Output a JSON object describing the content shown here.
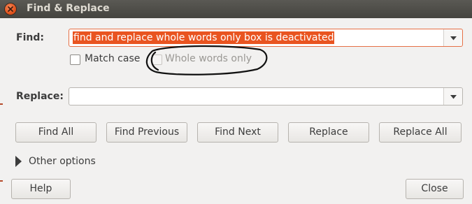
{
  "window": {
    "title": "Find & Replace"
  },
  "find": {
    "label": "Find:",
    "value": "find and replace whole words only box is deactivated"
  },
  "options": {
    "match_case": {
      "label": "Match case",
      "checked": false,
      "enabled": true
    },
    "whole_words": {
      "label": "Whole words only",
      "checked": false,
      "enabled": false
    }
  },
  "replace": {
    "label": "Replace:",
    "value": ""
  },
  "buttons": {
    "find_all": "Find All",
    "find_previous": "Find Previous",
    "find_next": "Find Next",
    "replace": "Replace",
    "replace_all": "Replace All"
  },
  "other_options": {
    "label": "Other options",
    "expanded": false
  },
  "footer": {
    "help": "Help",
    "close": "Close"
  },
  "colors": {
    "accent": "#e95420",
    "titlebar": "#4f4e49",
    "annotation": "#000000"
  },
  "icons": [
    "close-icon",
    "chevron-down-icon",
    "expander-arrow-icon"
  ]
}
